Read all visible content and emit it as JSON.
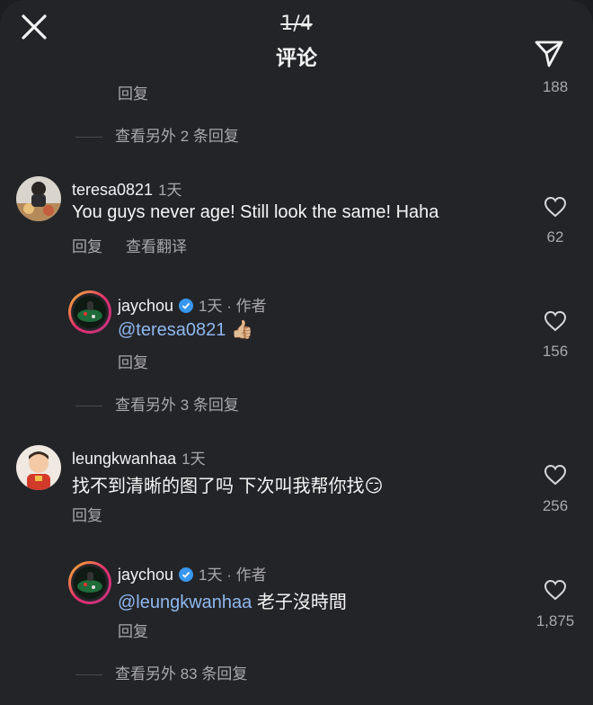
{
  "header": {
    "counter": "1/4",
    "title": "评论"
  },
  "top_remnant": {
    "reply": "回复",
    "like_count": "188",
    "view_more": "查看另外 2 条回复"
  },
  "comments": [
    {
      "username": "teresa0821",
      "time": "1天",
      "text": "You guys never age! Still look the same! Haha",
      "reply": "回复",
      "translate": "查看翻译",
      "likes": "62"
    },
    {
      "username": "jaychou",
      "time": "1天 · 作者",
      "mention": "@teresa0821",
      "text": "",
      "emoji": "👍🏼",
      "reply": "回复",
      "likes": "156",
      "view_more": "查看另外 3 条回复"
    },
    {
      "username": "leungkwanhaa",
      "time": "1天",
      "text": "找不到清晰的图了吗 下次叫我帮你找",
      "emoji": "😏",
      "reply": "回复",
      "likes": "256"
    },
    {
      "username": "jaychou",
      "time": "1天 · 作者",
      "mention": "@leungkwanhaa",
      "text": " 老子沒時間",
      "reply": "回复",
      "likes": "1,875",
      "view_more": "查看另外 83 条回复"
    }
  ],
  "colors": {
    "background": "#232428",
    "mention": "#8fb8f0",
    "verified": "#3897f0"
  }
}
